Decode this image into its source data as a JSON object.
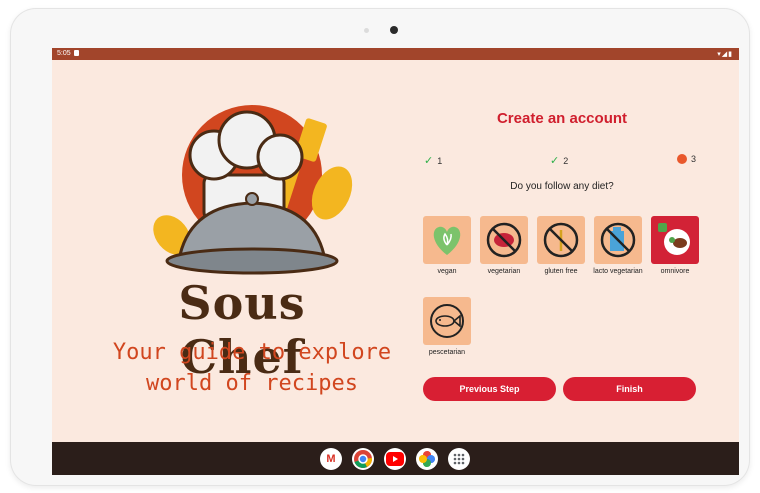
{
  "status": {
    "time": "5:05",
    "right": "▾◢▮"
  },
  "brand": {
    "title": "Sous Chef",
    "tagline_line1": "Your guide to explore",
    "tagline_line2": "world of recipes"
  },
  "form": {
    "title": "Create an account",
    "steps": [
      {
        "number": "1",
        "state": "done",
        "icon": "check-icon"
      },
      {
        "number": "2",
        "state": "done",
        "icon": "check-icon"
      },
      {
        "number": "3",
        "state": "current",
        "icon": "dot-icon"
      }
    ],
    "question": "Do you follow any diet?",
    "diets": [
      {
        "label": "vegan",
        "selected": false,
        "icon": "vegan-heart-icon"
      },
      {
        "label": "vegetarian",
        "selected": false,
        "icon": "no-meat-icon"
      },
      {
        "label": "gluten free",
        "selected": false,
        "icon": "no-wheat-icon"
      },
      {
        "label": "lacto vegetarian",
        "selected": false,
        "icon": "no-dairy-icon"
      },
      {
        "label": "omnivore",
        "selected": true,
        "icon": "omnivore-plate-icon"
      },
      {
        "label": "pescetarian",
        "selected": false,
        "icon": "fish-icon"
      }
    ],
    "previous_label": "Previous Step",
    "finish_label": "Finish"
  },
  "colors": {
    "accent": "#d81f33",
    "background": "#fbe9df",
    "statusbar": "#a2452b",
    "tile": "#f6b98e"
  },
  "dock_icons": [
    "gmail-icon",
    "chrome-icon",
    "youtube-icon",
    "photos-icon",
    "apps-icon"
  ]
}
